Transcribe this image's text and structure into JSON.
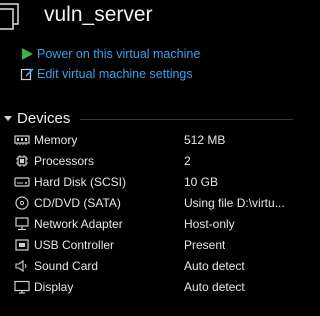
{
  "vm": {
    "name": "vuln_server"
  },
  "actions": {
    "power_on": "Power on this virtual machine",
    "edit_settings": "Edit virtual machine settings"
  },
  "devices": {
    "heading": "Devices",
    "items": [
      {
        "name": "Memory",
        "value": "512 MB",
        "icon": "memory-icon"
      },
      {
        "name": "Processors",
        "value": "2",
        "icon": "processor-icon"
      },
      {
        "name": "Hard Disk (SCSI)",
        "value": "10 GB",
        "icon": "hard-disk-icon"
      },
      {
        "name": "CD/DVD (SATA)",
        "value": "Using file D:\\virtu...",
        "icon": "cd-dvd-icon"
      },
      {
        "name": "Network Adapter",
        "value": "Host-only",
        "icon": "network-adapter-icon"
      },
      {
        "name": "USB Controller",
        "value": "Present",
        "icon": "usb-icon"
      },
      {
        "name": "Sound Card",
        "value": "Auto detect",
        "icon": "speaker-icon"
      },
      {
        "name": "Display",
        "value": "Auto detect",
        "icon": "monitor-icon"
      }
    ]
  },
  "colors": {
    "background": "#000000",
    "link": "#3aa0e8",
    "power_green": "#3cb043",
    "text": "#e6e6e6"
  }
}
